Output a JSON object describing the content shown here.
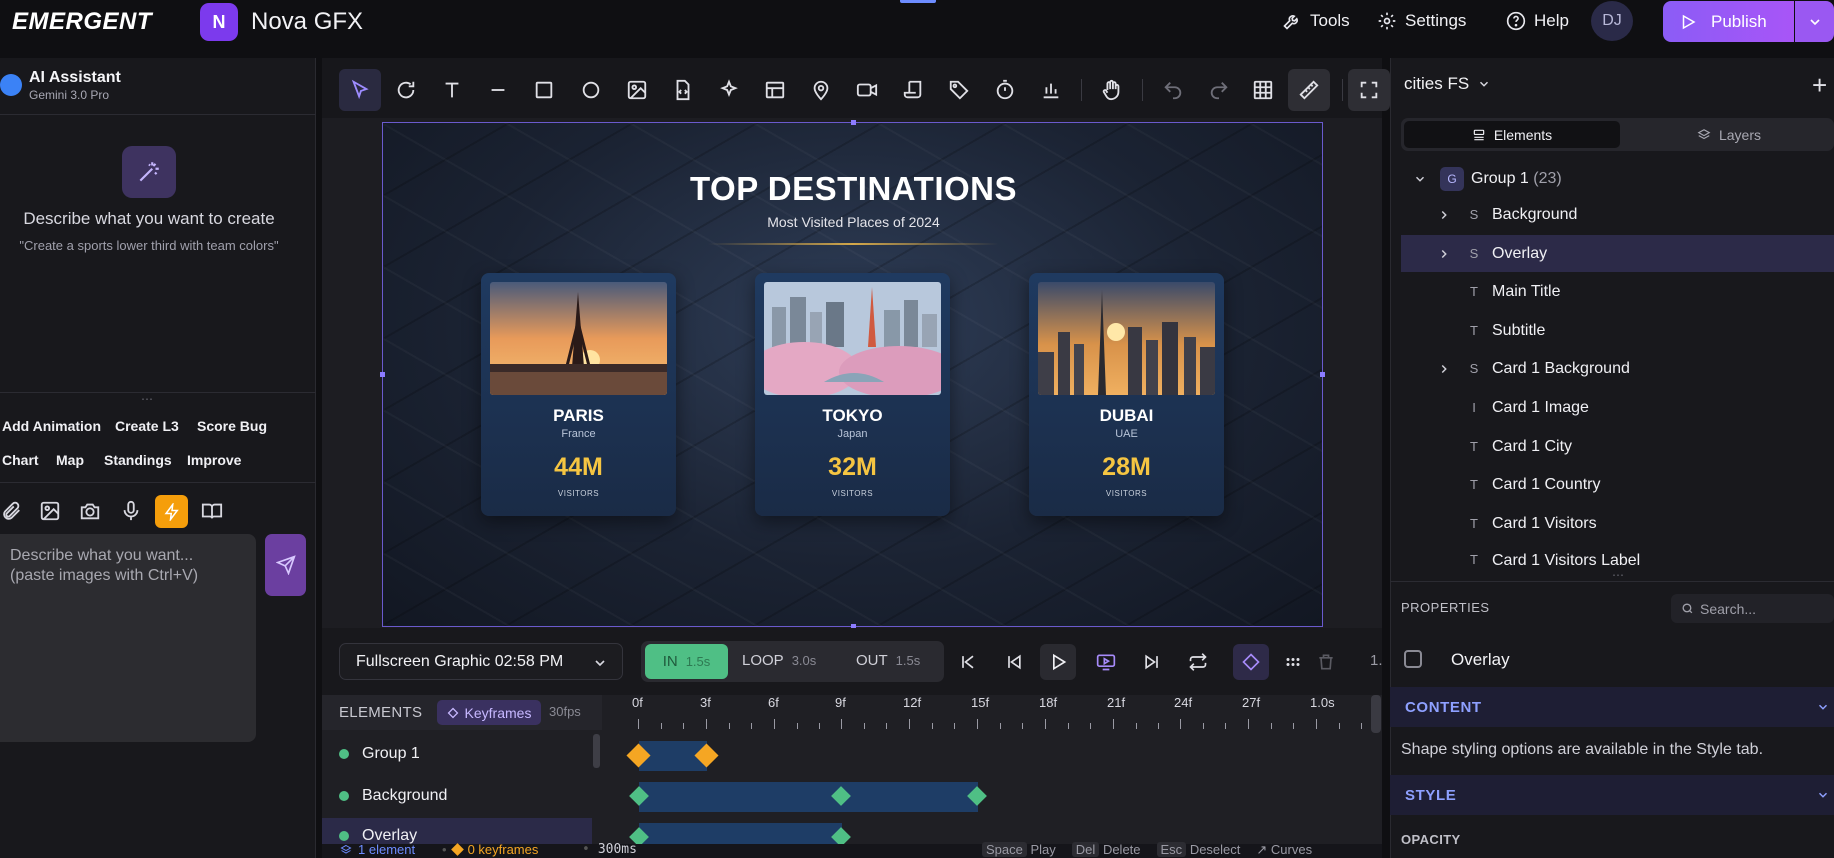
{
  "app": {
    "logo": "EMERGENT",
    "project_badge": "N",
    "project_name": "Nova GFX",
    "tools_label": "Tools",
    "settings_label": "Settings",
    "help_label": "Help",
    "avatar_initials": "DJ",
    "publish_label": "Publish"
  },
  "assistant": {
    "title": "AI Assistant",
    "model": "Gemini 3.0 Pro",
    "describe_title": "Describe what you want to create",
    "describe_hint": "\"Create a sports lower third with team colors\"",
    "chips_row1": [
      "Add Animation",
      "Create L3",
      "Score Bug"
    ],
    "chips_row2": [
      "Chart",
      "Map",
      "Standings",
      "Improve"
    ],
    "prompt_placeholder": "Describe what you want...\n(paste images with Ctrl+V)"
  },
  "graphic": {
    "title": "TOP DESTINATIONS",
    "subtitle": "Most Visited Places of 2024",
    "cards": [
      {
        "city": "PARIS",
        "country": "France",
        "visitors": "44M",
        "visitors_label": "VISITORS"
      },
      {
        "city": "TOKYO",
        "country": "Japan",
        "visitors": "32M",
        "visitors_label": "VISITORS"
      },
      {
        "city": "DUBAI",
        "country": "UAE",
        "visitors": "28M",
        "visitors_label": "VISITORS"
      }
    ]
  },
  "transport": {
    "scene": "Fullscreen Graphic 02:58 PM",
    "phases": [
      {
        "label": "IN",
        "duration": "1.5s"
      },
      {
        "label": "LOOP",
        "duration": "3.0s"
      },
      {
        "label": "OUT",
        "duration": "1.5s"
      }
    ],
    "speed": "1."
  },
  "timeline": {
    "elements_label": "ELEMENTS",
    "keyframes_label": "Keyframes",
    "fps": "30fps",
    "ticks": [
      "0f",
      "3f",
      "6f",
      "9f",
      "12f",
      "15f",
      "18f",
      "21f",
      "24f",
      "27f",
      "1.0s"
    ],
    "rows": [
      {
        "name": "Group 1"
      },
      {
        "name": "Background"
      },
      {
        "name": "Overlay"
      }
    ]
  },
  "status": {
    "selection": "1 element",
    "keyframes": "0 keyframes",
    "duration": "300ms",
    "shortcuts": [
      {
        "key": "Space",
        "action": "Play"
      },
      {
        "key": "Del",
        "action": "Delete"
      },
      {
        "key": "Esc",
        "action": "Deselect"
      }
    ],
    "curves": "Curves"
  },
  "layers_panel": {
    "composition": "cities FS",
    "tab_elements": "Elements",
    "tab_layers": "Layers",
    "group": {
      "badge": "G",
      "name": "Group 1",
      "count": "(23)"
    },
    "items": [
      {
        "type": "S",
        "name": "Background",
        "expandable": true
      },
      {
        "type": "S",
        "name": "Overlay",
        "expandable": true,
        "selected": true
      },
      {
        "type": "T",
        "name": "Main Title"
      },
      {
        "type": "T",
        "name": "Subtitle"
      },
      {
        "type": "S",
        "name": "Card 1 Background",
        "expandable": true
      },
      {
        "type": "I",
        "name": "Card 1 Image"
      },
      {
        "type": "T",
        "name": "Card 1 City"
      },
      {
        "type": "T",
        "name": "Card 1 Country"
      },
      {
        "type": "T",
        "name": "Card 1 Visitors"
      },
      {
        "type": "T",
        "name": "Card 1 Visitors Label"
      }
    ]
  },
  "properties": {
    "label": "PROPERTIES",
    "search_placeholder": "Search...",
    "selected_name": "Overlay",
    "content_label": "CONTENT",
    "content_note": "Shape styling options are available in the Style tab.",
    "style_label": "STYLE",
    "opacity_label": "OPACITY"
  },
  "colors": {
    "accent": "#8b5cf6",
    "phase_in": "#4fbf85",
    "keyframe_group": "#f5a623",
    "keyframe_element": "#4fbf85",
    "gold": "#f5c542"
  }
}
